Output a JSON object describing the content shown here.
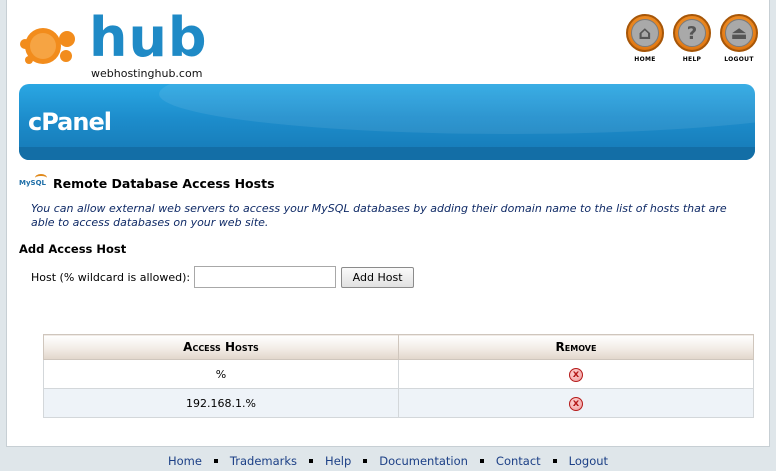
{
  "header": {
    "logo_word": "hub",
    "logo_sub": "webhostinghub.com",
    "nav": [
      {
        "label": "HOME",
        "icon": "home-icon",
        "glyph": "⌂"
      },
      {
        "label": "HELP",
        "icon": "help-icon",
        "glyph": "?"
      },
      {
        "label": "LOGOUT",
        "icon": "logout-icon",
        "glyph": "⏏"
      }
    ]
  },
  "banner": {
    "title": "cPanel"
  },
  "page": {
    "icon_text": "MySQL",
    "title": "Remote Database Access Hosts",
    "description": "You can allow external web servers to access your MySQL databases by adding their domain name to the list of hosts that are able to access databases on your web site.",
    "add_section_title": "Add Access Host",
    "host_label": "Host (% wildcard is allowed):",
    "host_value": "",
    "host_placeholder": "",
    "add_button": "Add Host"
  },
  "table": {
    "headers": [
      "Access Hosts",
      "Remove"
    ],
    "rows": [
      {
        "host": "%",
        "remove_glyph": "x"
      },
      {
        "host": "192.168.1.%",
        "remove_glyph": "x"
      }
    ]
  },
  "footer": {
    "links": [
      "Home",
      "Trademarks",
      "Help",
      "Documentation",
      "Contact",
      "Logout"
    ]
  },
  "colors": {
    "brand_blue": "#1f8ac6",
    "brand_orange": "#e37a14",
    "link": "#1b3f86",
    "remove_red": "#b51a1a"
  }
}
